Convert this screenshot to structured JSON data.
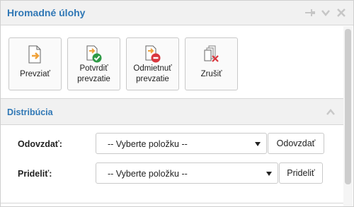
{
  "panel": {
    "title": "Hromadné úlohy",
    "header_icons": [
      "pin-icon",
      "chevron-down-icon",
      "close-icon"
    ]
  },
  "toolbar": {
    "buttons": [
      {
        "label": "Prevziať",
        "icon": "take-over-icon"
      },
      {
        "label": "Potvrdiť prevzatie",
        "line1": "Potvrdiť",
        "line2": "prevzatie",
        "icon": "confirm-takeover-icon"
      },
      {
        "label": "Odmietnuť prevzatie",
        "line1": "Odmietnuť",
        "line2": "prevzatie",
        "icon": "reject-takeover-icon"
      },
      {
        "label": "Zrušiť",
        "icon": "cancel-icon"
      }
    ]
  },
  "distribution": {
    "title": "Distribúcia",
    "rows": [
      {
        "label": "Odovzdať:",
        "select_value": "-- Vyberte položku --",
        "button_label": "Odovzdať"
      },
      {
        "label": "Prideliť:",
        "select_value": "-- Vyberte položku --",
        "button_label": "Prideliť"
      }
    ]
  },
  "colors": {
    "accent": "#2f77b5",
    "header_bg": "#f1f1f1",
    "orange": "#f0a23a",
    "green": "#2e9a46",
    "red": "#d9363e"
  }
}
